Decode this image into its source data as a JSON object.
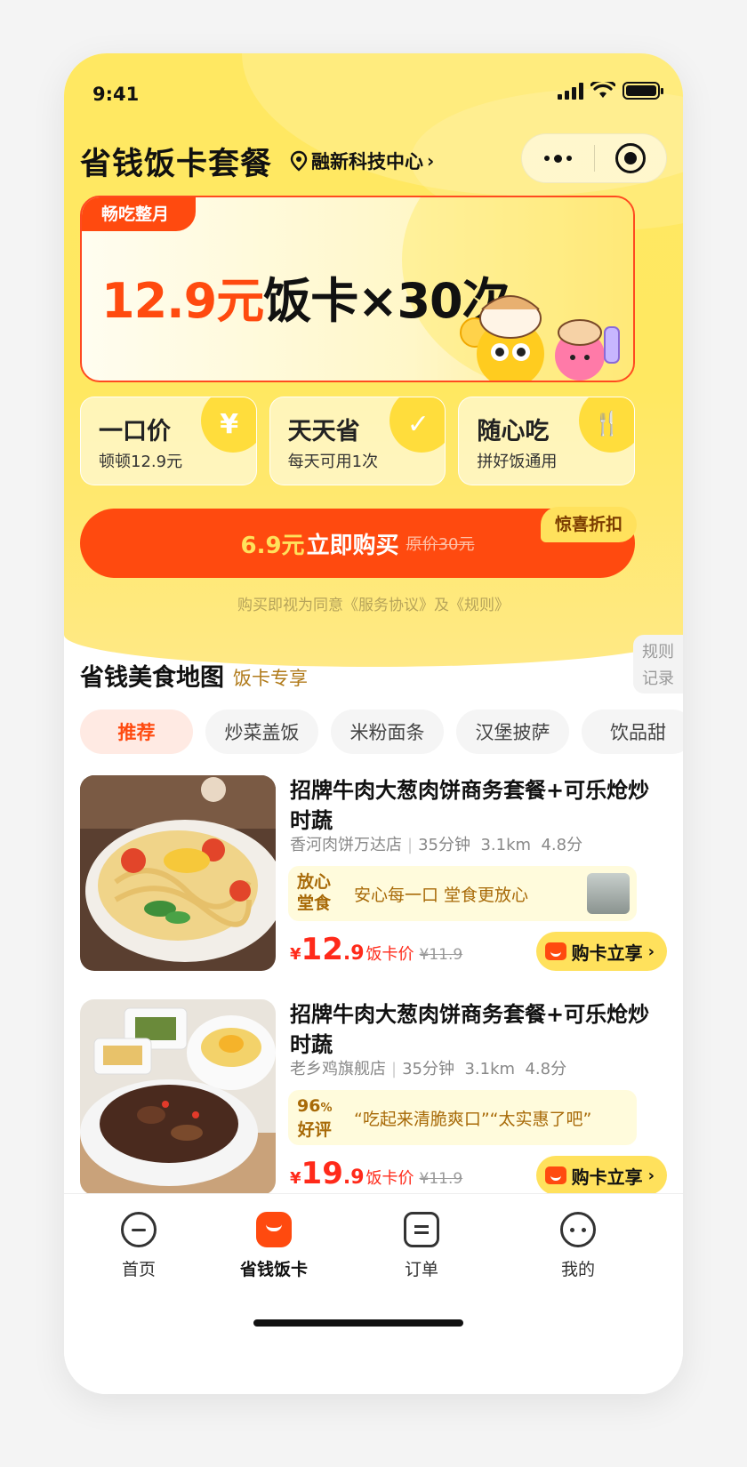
{
  "status_bar": {
    "time": "9:41"
  },
  "header": {
    "title": "省钱饭卡套餐",
    "location": "融新科技中心"
  },
  "banner": {
    "tag": "畅吃整月",
    "price": "12.9元",
    "rest": "饭卡×30次"
  },
  "features": [
    {
      "title": "一口价",
      "sub": "顿顿12.9元",
      "icon": "yen-icon",
      "glyph": "¥"
    },
    {
      "title": "天天省",
      "sub": "每天可用1次",
      "icon": "calendar-check-icon",
      "glyph": "✓"
    },
    {
      "title": "随心吃",
      "sub": "拼好饭通用",
      "icon": "fork-knife-icon",
      "glyph": "🍴"
    }
  ],
  "buy": {
    "price": "6.9元",
    "label": "立即购买",
    "original": "原价30元",
    "badge": "惊喜折扣"
  },
  "agreement": "购买即视为同意《服务协议》及《规则》",
  "map": {
    "title": "省钱美食地图",
    "subtitle": "饭卡专享",
    "side_tab_top": "规则",
    "side_tab_bottom": "记录"
  },
  "categories": [
    "推荐",
    "炒菜盖饭",
    "米粉面条",
    "汉堡披萨",
    "饮品甜"
  ],
  "products": [
    {
      "name": "招牌牛肉大葱肉饼商务套餐+可乐炝炒时蔬",
      "shop": "香河肉饼万达店",
      "time": "35分钟",
      "distance": "3.1km",
      "rating": "4.8分",
      "tag_line1": "放心",
      "tag_line2": "堂食",
      "highlight": "安心每一口 堂食更放心",
      "price_yen": "¥",
      "price_int": "12",
      "price_dec": ".9",
      "price_label": "饭卡价",
      "orig_price": "¥11.9",
      "button": "购卡立享"
    },
    {
      "name": "招牌牛肉大葱肉饼商务套餐+可乐炝炒时蔬",
      "shop": "老乡鸡旗舰店",
      "time": "35分钟",
      "distance": "3.1km",
      "rating": "4.8分",
      "tag_line1": "96",
      "tag_pct": "%",
      "tag_line2": "好评",
      "highlight": "“吃起来清脆爽口”“太实惠了吧”",
      "price_yen": "¥",
      "price_int": "19",
      "price_dec": ".9",
      "price_label": "饭卡价",
      "orig_price": "¥11.9",
      "button": "购卡立享"
    }
  ],
  "tabbar": [
    {
      "label": "首页",
      "icon": "home-face-icon"
    },
    {
      "label": "省钱饭卡",
      "icon": "meal-card-icon",
      "active": true
    },
    {
      "label": "订单",
      "icon": "order-icon"
    },
    {
      "label": "我的",
      "icon": "profile-icon"
    }
  ],
  "colors": {
    "brand_yellow": "#ffe862",
    "accent_orange": "#ff4a0f",
    "price_red": "#ff2a1a"
  }
}
